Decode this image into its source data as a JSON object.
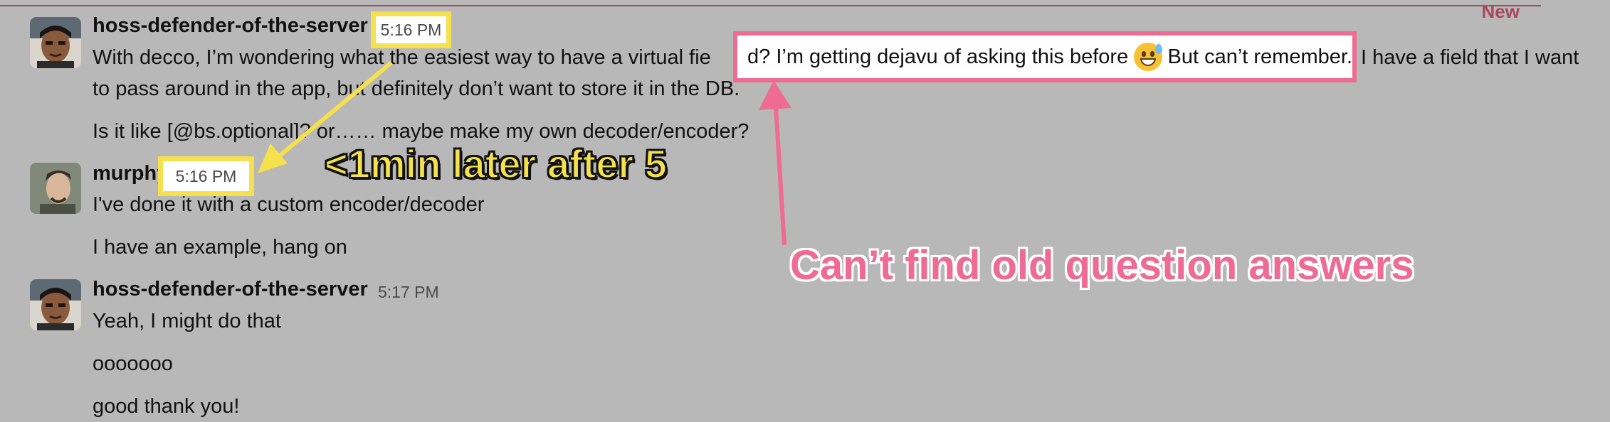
{
  "divider": {
    "label": "New"
  },
  "messages": [
    {
      "user": "hoss-defender-of-the-server",
      "time": "5:16 PM",
      "line1_a": "With decco, I’m wondering what the easiest way to have a virtual fie",
      "line1_b": "I have a field that I want",
      "line2": "to pass around in the app, but definitely don’t want to store it in the DB.",
      "line3": "Is it like [@bs.optional]? or…… maybe make my own decoder/encoder?",
      "highlight_a": "d? I’m getting dejavu of asking this before",
      "highlight_b": "But can’t remember."
    },
    {
      "user": "murphy",
      "time": "5:16 PM",
      "line1": "I've done it with a custom encoder/decoder",
      "line2": "I have an example, hang on"
    },
    {
      "user": "hoss-defender-of-the-server",
      "time": "5:17 PM",
      "line1": "Yeah, I might do that",
      "line2": "ooooooo",
      "line3": "good thank you!"
    }
  ],
  "annotations": {
    "yellow": "<1min later after 5",
    "pink": "Can’t find old question answers"
  },
  "colors": {
    "highlight_yellow": "#f5e04d",
    "highlight_pink": "#ee6b93",
    "new_divider": "#a8475f"
  },
  "icons": [
    "avatar-hoss",
    "avatar-murphy",
    "grinning-sweat-emoji"
  ]
}
